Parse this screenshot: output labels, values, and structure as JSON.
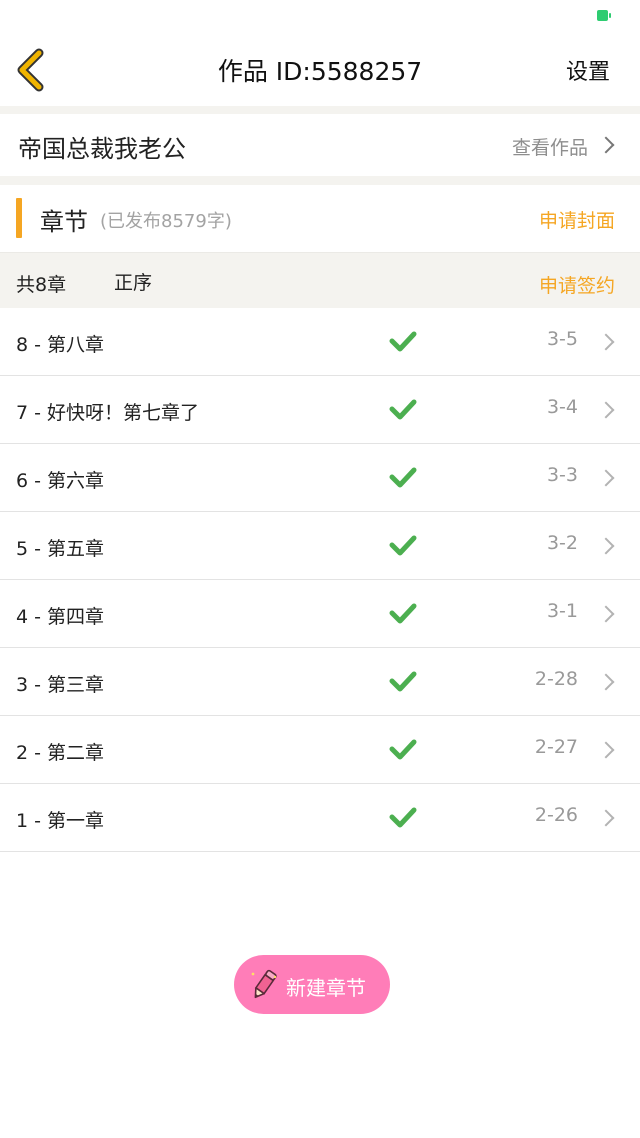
{
  "status": {
    "battery_color": "#2ecc71"
  },
  "nav": {
    "back_icon": "chevron-left-icon",
    "title": "作品 ID:5588257",
    "settings_label": "设置"
  },
  "work": {
    "title": "帝国总裁我老公",
    "view_label": "查看作品"
  },
  "section": {
    "title": "章节",
    "subtitle": "(已发布8579字)",
    "cover_label": "申请封面"
  },
  "subbar": {
    "count_label": "共8章",
    "order_label": "正序",
    "sign_label": "申请签约"
  },
  "chapters": [
    {
      "title": "8 - 第八章",
      "date": "3-5"
    },
    {
      "title": "7 - 好快呀！第七章了",
      "date": "3-4"
    },
    {
      "title": "6 - 第六章",
      "date": "3-3"
    },
    {
      "title": "5 - 第五章",
      "date": "3-2"
    },
    {
      "title": "4 - 第四章",
      "date": "3-1"
    },
    {
      "title": "3 - 第三章",
      "date": "2-28"
    },
    {
      "title": "2 - 第二章",
      "date": "2-27"
    },
    {
      "title": "1 - 第一章",
      "date": "2-26"
    }
  ],
  "fab": {
    "label": "新建章节",
    "icon": "pencil-icon"
  },
  "colors": {
    "accent": "#f5a623",
    "check": "#4caf50",
    "fab": "#ff7db8",
    "back_chevron": "#f0b400"
  }
}
